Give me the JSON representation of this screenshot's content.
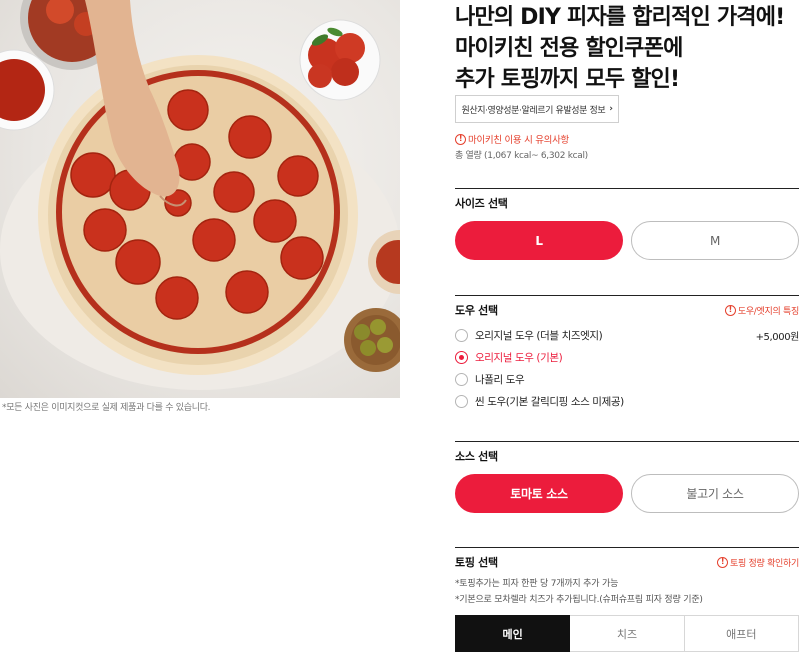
{
  "photo": {
    "caption": "*모든 사진은 이미지컷으로 실제 제품과 다를 수 있습니다."
  },
  "product": {
    "title": "나만의 DIY 피자를 합리적인 가격에!\n마이키친 전용 할인쿠폰에\n추가 토핑까지 모두 할인!",
    "origin_button": "원산지·영양성분·알레르기 유발성분 정보",
    "notice": "마이키친 이용 시 유의사항",
    "kcal": "총 열량 (1,067 kcal~ 6,302 kcal)"
  },
  "size": {
    "title": "사이즈 선택",
    "options": [
      {
        "label": "L",
        "selected": true
      },
      {
        "label": "M",
        "selected": false
      }
    ]
  },
  "dough": {
    "title": "도우 선택",
    "link": "도우/엣지의 특징",
    "options": [
      {
        "label": "오리지널 도우 (더블 치즈엣지)",
        "price": "+5,000원",
        "selected": false
      },
      {
        "label": "오리지널 도우 (기본)",
        "price": "",
        "selected": true
      },
      {
        "label": "나폴리 도우",
        "price": "",
        "selected": false
      },
      {
        "label": "씬 도우(기본 갈릭디핑 소스 미제공)",
        "price": "",
        "selected": false
      }
    ]
  },
  "sauce": {
    "title": "소스 선택",
    "options": [
      {
        "label": "토마토 소스",
        "selected": true
      },
      {
        "label": "불고기 소스",
        "selected": false
      }
    ]
  },
  "topping": {
    "title": "토핑 선택",
    "link": "토핑 정량 확인하기",
    "notes": [
      "*토핑추가는 피자 한판 당 7개까지 추가 가능",
      "*기본으로 모차렐라 치즈가 추가됩니다.(슈퍼슈프림 피자 정량 기준)"
    ],
    "tabs": [
      {
        "label": "메인",
        "selected": true
      },
      {
        "label": "치즈",
        "selected": false
      },
      {
        "label": "애프터",
        "selected": false
      }
    ]
  },
  "icons": {
    "info": "info-circle-icon",
    "chevron": "chevron-right-icon"
  },
  "colors": {
    "accent": "#ec1c3c",
    "notice": "#e5412e",
    "dark_tab": "#111111"
  }
}
